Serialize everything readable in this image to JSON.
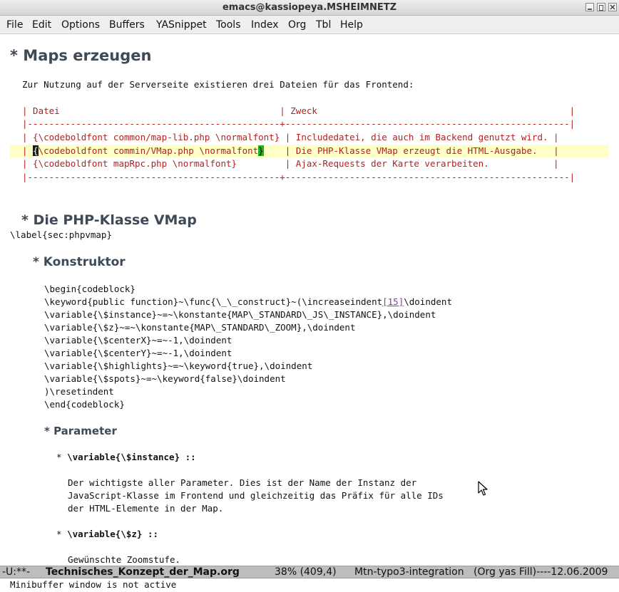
{
  "window": {
    "title": "emacs@kassiopeya.MSHEIMNETZ"
  },
  "menu": [
    "File",
    "Edit",
    "Options",
    "Buffers",
    "YASnippet",
    "Tools",
    "Index",
    "Org",
    "Tbl",
    "Help"
  ],
  "buffer": {
    "h1": "* Maps erzeugen",
    "intro": "Zur Nutzung auf der Serverseite existieren drei Dateien für das Frontend:",
    "table": {
      "header": "| Datei                                         | Zweck                                               |",
      "rule": "|-----------------------------------------------+-----------------------------------------------------|",
      "row1": "| {\\codeboldfont common/map-lib.php \\normalfont} | Includedatei, die auch im Backend genutzt wird. |",
      "row2_bar": "| ",
      "row2_cursor": "{",
      "row2_mid": "\\codeboldfont commin/VMap.php \\normalfont",
      "row2_paren": "}",
      "row2_rest": "    | Die PHP-Klasse VMap erzeugt die HTML-Ausgabe.   |",
      "row3": "| {\\codeboldfont mapRpc.php \\normalfont}         | Ajax-Requests der Karte verarbeiten.            |",
      "rule_end": "|-----------------------------------------------+-----------------------------------------------------|"
    },
    "h2": "* Die PHP-Klasse VMap",
    "label": "\\label{sec:phpvmap}",
    "h3": "* Konstruktor",
    "code": {
      "l1": "\\begin{codeblock}",
      "l2_pre": "\\keyword{public function}~\\func{\\_\\_construct}~(\\increaseindent",
      "l2_link": "[15]",
      "l2_post": "\\doindent",
      "l3": "\\variable{\\$instance}~=~\\konstante{MAP\\_STANDARD\\_JS\\_INSTANCE},\\doindent",
      "l4": "\\variable{\\$z}~=~\\konstante{MAP\\_STANDARD\\_ZOOM},\\doindent",
      "l5": "\\variable{\\$centerX}~=~-1,\\doindent",
      "l6": "\\variable{\\$centerY}~=~-1,\\doindent",
      "l7": "\\variable{\\$highlights}~=~\\keyword{true},\\doindent",
      "l8": "\\variable{\\$spots}~=~\\keyword{false}\\doindent",
      "l9": ")\\resetindent",
      "l10": "\\end{codeblock}"
    },
    "h4": "* Parameter",
    "param1_bullet": "* ",
    "param1_term": "\\variable{\\$instance} ::",
    "param1_desc": [
      "Der wichtigste aller Parameter. Dies ist der Name der Instanz der",
      "JavaScript-Klasse im Frontend und gleichzeitig das Präfix für alle IDs",
      "der HTML-Elemente in der Map."
    ],
    "param2_bullet": "* ",
    "param2_term": "\\variable{\\$z} ::",
    "param2_desc": "Gewünschte Zoomstufe."
  },
  "modeline": {
    "status": "-U:**-",
    "buffer_name": "Technisches_Konzept_der_Map.org",
    "position": "38% (409,4)",
    "project": "Mtn-typo3-integration",
    "modes": "(Org yas Fill)----12.06.2009"
  },
  "minibuffer": {
    "message": "Minibuffer window is not active"
  }
}
